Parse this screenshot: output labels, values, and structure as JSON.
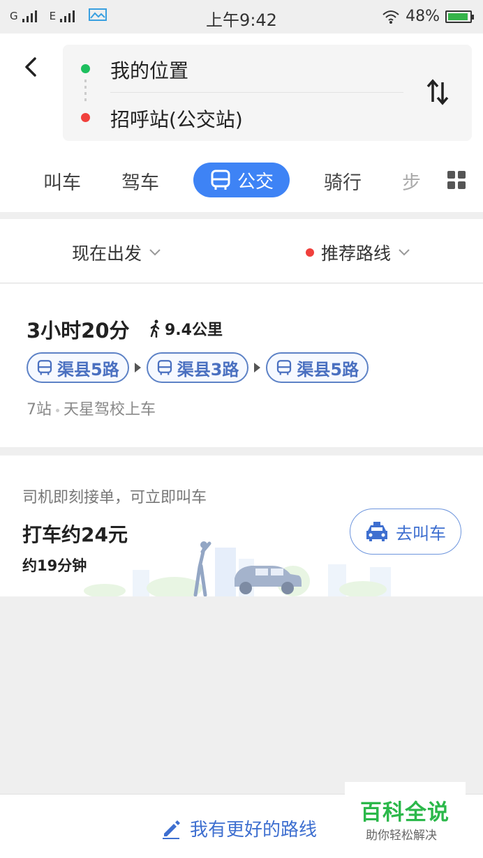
{
  "status_bar": {
    "carrier1": "G",
    "carrier2": "E",
    "time": "上午9:42",
    "battery": "48%"
  },
  "header": {
    "from": "我的位置",
    "to": "招呼站(公交站)"
  },
  "tabs": {
    "items": [
      "叫车",
      "驾车",
      "公交",
      "骑行",
      "步"
    ],
    "active": "公交"
  },
  "options": {
    "depart": "现在出发",
    "route_pref": "推荐路线"
  },
  "route": {
    "duration": "3小时20分",
    "walk": "9.4公里",
    "buses": [
      "渠县5路",
      "渠县3路",
      "渠县5路"
    ],
    "stops": "7站",
    "board": "天星驾校上车"
  },
  "taxi": {
    "tip": "司机即刻接单，可立即叫车",
    "price": "打车约24元",
    "time": "约19分钟",
    "button": "去叫车"
  },
  "bottom": {
    "better_route": "我有更好的路线"
  },
  "watermark": {
    "title": "百科全说",
    "subtitle": "助你轻松解决"
  },
  "colors": {
    "accent": "#3e83f5",
    "green": "#1dbf5e",
    "red": "#f0403c",
    "watermark_green": "#2bb84a"
  }
}
